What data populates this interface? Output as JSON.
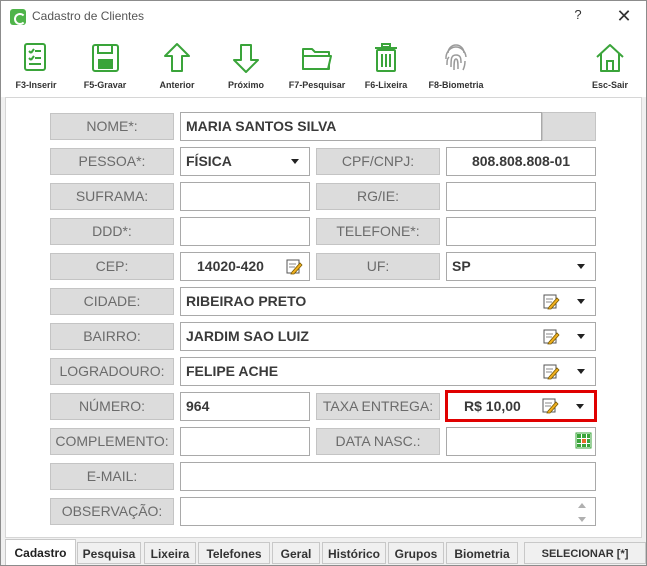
{
  "window": {
    "title": "Cadastro de Clientes",
    "help_glyph": "?",
    "close_glyph": "✕"
  },
  "toolbar": {
    "inserir": "F3-Inserir",
    "gravar": "F5-Gravar",
    "anterior": "Anterior",
    "proximo": "Próximo",
    "pesquisar": "F7-Pesquisar",
    "lixeira": "F6-Lixeira",
    "biometria": "F8-Biometria",
    "sair": "Esc-Sair"
  },
  "form": {
    "nome_label": "NOME*:",
    "nome_value": "MARIA SANTOS SILVA",
    "pessoa_label": "PESSOA*:",
    "pessoa_value": "FÍSICA",
    "cpf_label": "CPF/CNPJ:",
    "cpf_value": "808.808.808-01",
    "suframa_label": "SUFRAMA:",
    "suframa_value": "",
    "rg_label": "RG/IE:",
    "rg_value": "",
    "ddd_label": "DDD*:",
    "ddd_value": "",
    "telefone_label": "TELEFONE*:",
    "telefone_value": "",
    "cep_label": "CEP:",
    "cep_value": "14020-420",
    "uf_label": "UF:",
    "uf_value": "SP",
    "cidade_label": "CIDADE:",
    "cidade_value": "RIBEIRAO PRETO",
    "bairro_label": "BAIRRO:",
    "bairro_value": "JARDIM SAO LUIZ",
    "logradouro_label": "LOGRADOURO:",
    "logradouro_value": "FELIPE ACHE",
    "numero_label": "NÚMERO:",
    "numero_value": "964",
    "taxa_label": "TAXA ENTREGA:",
    "taxa_value": "R$ 10,00",
    "complemento_label": "COMPLEMENTO:",
    "complemento_value": "",
    "data_nasc_label": "DATA NASC.:",
    "data_nasc_value": "",
    "email_label": "E-MAIL:",
    "email_value": "",
    "observacao_label": "OBSERVAÇÃO:",
    "observacao_value": ""
  },
  "tabs": {
    "cadastro": "Cadastro",
    "pesquisa": "Pesquisa",
    "lixeira": "Lixeira",
    "telefones": "Telefones",
    "geral": "Geral",
    "historico": "Histórico",
    "grupos": "Grupos",
    "biometria": "Biometria",
    "selecionar": "SELECIONAR [*]"
  },
  "colors": {
    "highlight": "#e00000",
    "icon_green": "#4fb44a",
    "label_bg": "#dcdcdc"
  },
  "icons": {
    "inserir": "checklist-icon",
    "gravar": "floppy-disk-icon",
    "anterior": "arrow-up-icon",
    "proximo": "arrow-down-icon",
    "pesquisar": "folder-icon",
    "lixeira": "trash-icon",
    "biometria": "fingerprint-icon",
    "sair": "home-icon"
  }
}
